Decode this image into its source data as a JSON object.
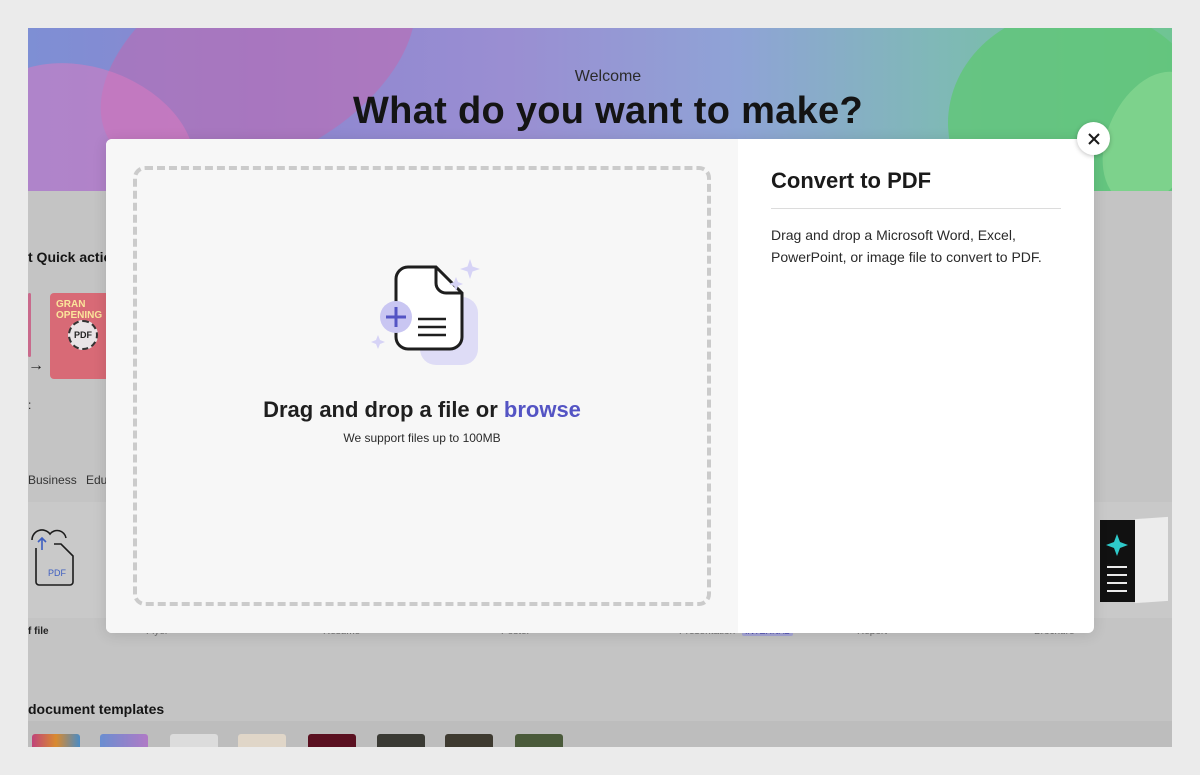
{
  "hero": {
    "welcome": "Welcome",
    "title": "What do you want to make?"
  },
  "background": {
    "quick_actions_heading": "t Quick actio",
    "grand_opening_text": "GRAN\nOPENING",
    "pdf_badge": "PDF",
    "arrow": "→",
    "colon": ":",
    "categories": [
      "Business",
      "Edu"
    ],
    "cloud_doc_label": "PDF",
    "tiles": {
      "file": "f file",
      "flyer": "Flyer",
      "resume": "Resume",
      "poster": "Poster",
      "presentation": "Presentation",
      "presentation_badge": "INTERNAL",
      "report": "Report",
      "brochure": "Brochure"
    },
    "templates_heading": "document templates"
  },
  "modal": {
    "drop_title_prefix": "Drag and drop a file or ",
    "browse_label": "browse",
    "drop_subtitle": "We support files up to 100MB",
    "info_title": "Convert to PDF",
    "info_description": "Drag and drop a Microsoft Word, Excel, PowerPoint, or image file to convert to PDF.",
    "close_icon": "close-icon"
  },
  "colors": {
    "accent": "#5454c4",
    "illustration_fill": "#dedcf6",
    "dashed_border": "#cbcbcb"
  }
}
